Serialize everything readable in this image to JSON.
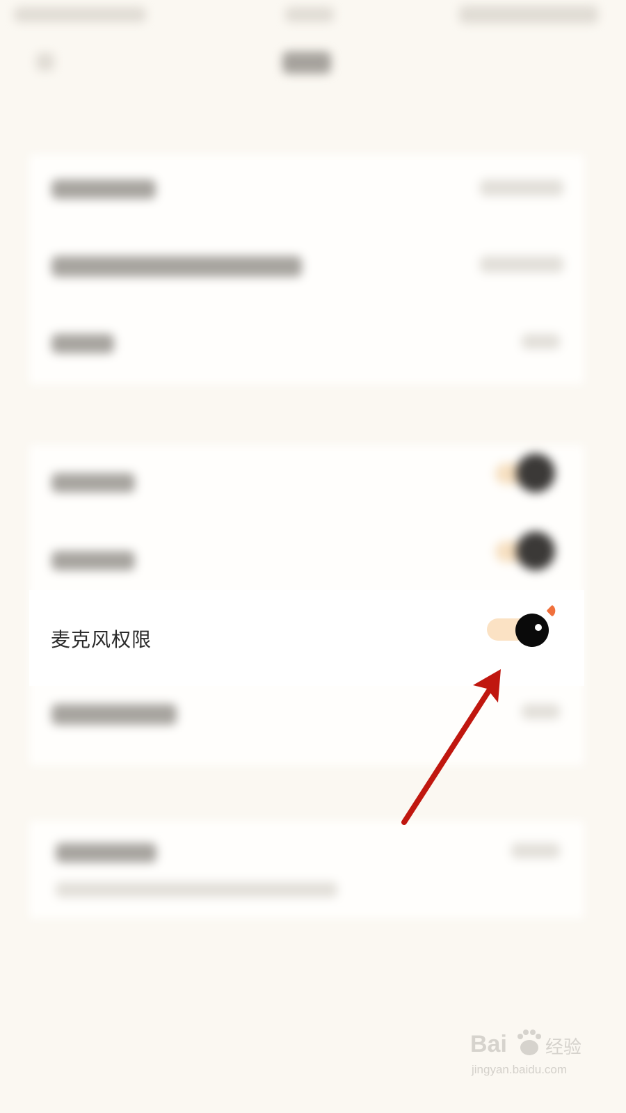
{
  "settings": {
    "highlighted_item": {
      "label": "麦克风权限",
      "toggle_state": "on",
      "toggle_track_color": "#fbe2c4",
      "toggle_knob_color": "#0a0a0a",
      "badge_color": "#f0703c"
    }
  },
  "annotation": {
    "arrow_color": "#c0170f",
    "points_to": "mic-permission-toggle"
  },
  "watermark": {
    "logo_text": "Bai 经验",
    "url": "jingyan.baidu.com"
  },
  "colors": {
    "background": "#fbf8f2",
    "card": "#fffefc"
  }
}
